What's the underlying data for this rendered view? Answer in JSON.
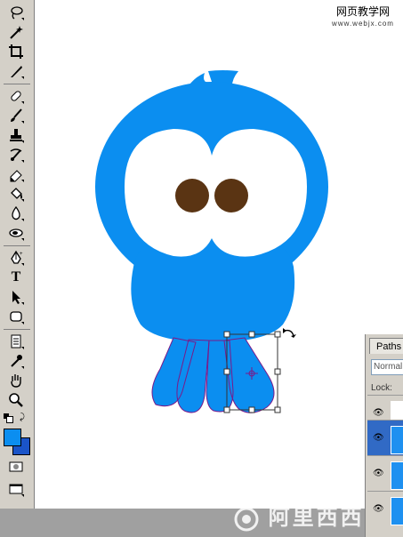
{
  "watermark": {
    "title": "网页教学网",
    "url": "www.webjx.com",
    "bottom_text": "阿里西西"
  },
  "panel": {
    "tab_label": "Paths",
    "blend_mode": "Normal",
    "lock_label": "Lock:"
  },
  "toolbar": {
    "tools": [
      "lasso-icon",
      "magic-wand-icon",
      "crop-icon",
      "slice-icon",
      "healing-brush-icon",
      "brush-icon",
      "clone-stamp-icon",
      "history-brush-icon",
      "eraser-icon",
      "paint-bucket-icon",
      "blur-icon",
      "dodge-icon",
      "pen-icon",
      "type-icon",
      "path-selection-icon",
      "shape-icon",
      "notes-icon",
      "eyedropper-icon",
      "hand-icon",
      "zoom-icon"
    ],
    "type_glyph": "T"
  },
  "colors": {
    "body": "#0b8ef0",
    "pupil": "#5a3413",
    "path": "#7a1a8a",
    "foreground_swatch": "#0b8ef0",
    "background_swatch": "#1a54c8"
  }
}
